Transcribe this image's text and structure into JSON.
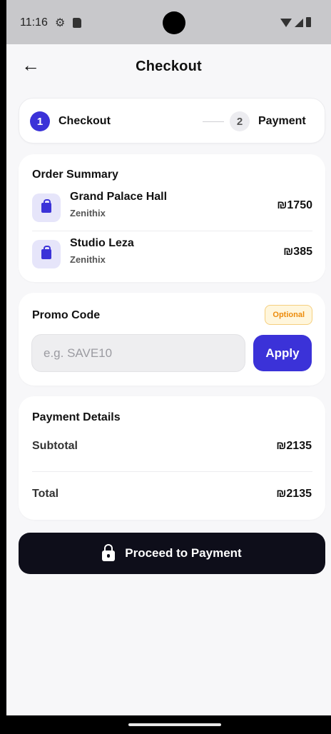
{
  "status_bar": {
    "time": "11:16"
  },
  "header": {
    "title": "Checkout"
  },
  "stepper": {
    "steps": [
      {
        "number": "1",
        "label": "Checkout",
        "active": true
      },
      {
        "number": "2",
        "label": "Payment",
        "active": false
      }
    ]
  },
  "order_summary": {
    "title": "Order Summary",
    "items": [
      {
        "name": "Grand Palace Hall",
        "vendor": "Zenithix",
        "price": "₪1750"
      },
      {
        "name": "Studio Leza",
        "vendor": "Zenithix",
        "price": "₪385"
      }
    ]
  },
  "promo": {
    "title": "Promo Code",
    "badge": "Optional",
    "placeholder": "e.g. SAVE10",
    "value": "",
    "apply_label": "Apply"
  },
  "payment_details": {
    "title": "Payment Details",
    "subtotal_label": "Subtotal",
    "subtotal_value": "₪2135",
    "total_label": "Total",
    "total_value": "₪2135"
  },
  "proceed_label": "Proceed to Payment",
  "colors": {
    "accent": "#3b32d8",
    "dark_button": "#0e0e1a",
    "badge_text": "#ec8b0b",
    "background": "#f7f7f9"
  },
  "icons": [
    "gear-icon",
    "sd-card-icon",
    "wifi-icon",
    "signal-icon",
    "battery-icon",
    "back-arrow-icon",
    "shopping-bag-icon",
    "lock-icon"
  ]
}
